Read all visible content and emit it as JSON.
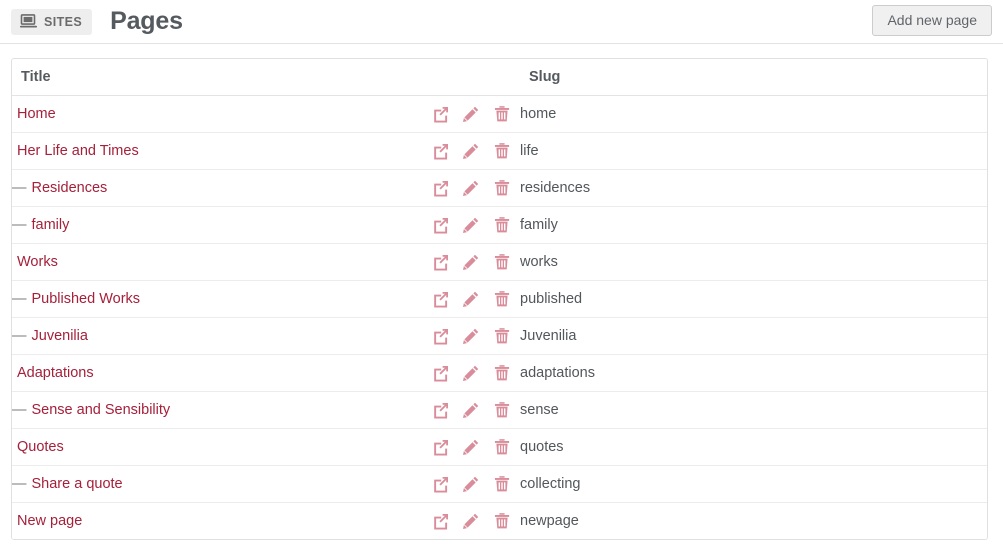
{
  "topbar": {
    "sites_button_label": "SITES",
    "sites_icon": "monitor-icon",
    "page_title": "Pages",
    "add_new_page_label": "Add new page"
  },
  "colors": {
    "title_link": "#a5213a",
    "action_icon": "#d98c99",
    "slug_text": "#52575c",
    "header_text": "#555a5f",
    "border": "#e0e0e0",
    "button_bg": "#f0f0f0",
    "sites_bg": "#eeeeee"
  },
  "table": {
    "columns": {
      "title": "Title",
      "actions": "",
      "slug": "Slug"
    },
    "action_icons": [
      {
        "name": "external-link-icon",
        "label": "View page"
      },
      {
        "name": "pencil-icon",
        "label": "Edit page"
      },
      {
        "name": "trash-icon",
        "label": "Delete page"
      }
    ],
    "rows": [
      {
        "dash": "",
        "title": "Home",
        "slug": "home"
      },
      {
        "dash": "",
        "title": "Her Life and Times",
        "slug": "life"
      },
      {
        "dash": "—",
        "title": "Residences",
        "slug": "residences"
      },
      {
        "dash": "—",
        "title": "family",
        "slug": "family"
      },
      {
        "dash": "",
        "title": "Works",
        "slug": "works"
      },
      {
        "dash": "—",
        "title": "Published Works",
        "slug": "published"
      },
      {
        "dash": "—",
        "title": "Juvenilia",
        "slug": "Juvenilia"
      },
      {
        "dash": "",
        "title": "Adaptations",
        "slug": "adaptations"
      },
      {
        "dash": "—",
        "title": "Sense and Sensibility",
        "slug": "sense"
      },
      {
        "dash": "",
        "title": "Quotes",
        "slug": "quotes"
      },
      {
        "dash": "—",
        "title": "Share a quote",
        "slug": "collecting"
      },
      {
        "dash": "",
        "title": "New page",
        "slug": "newpage"
      }
    ]
  }
}
